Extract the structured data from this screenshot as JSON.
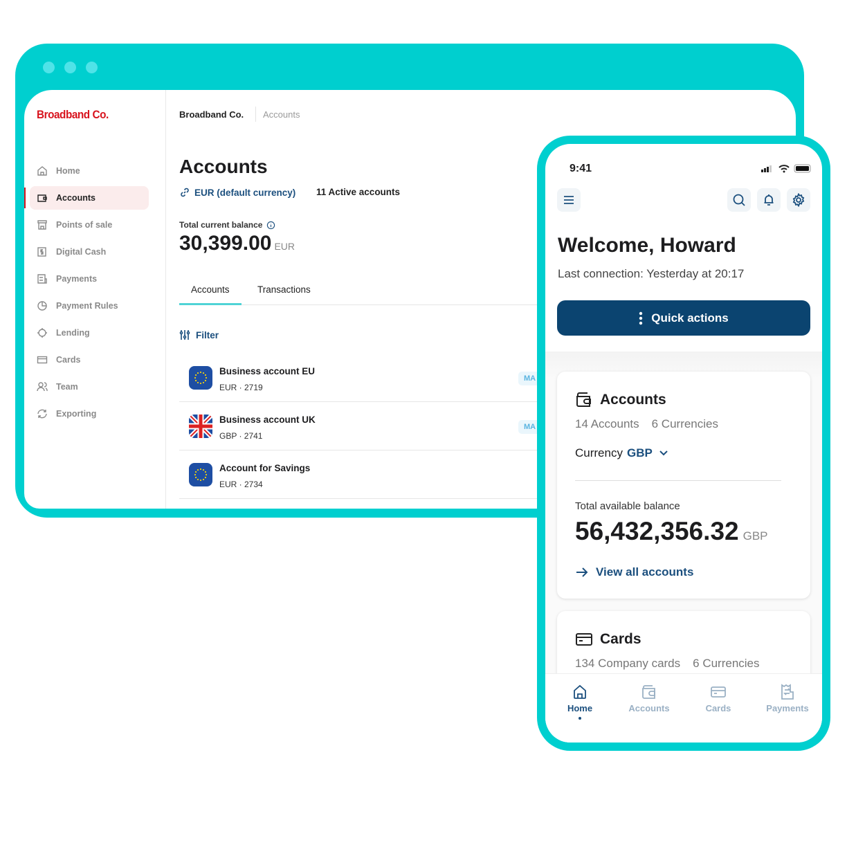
{
  "desktop": {
    "logo": "Broadband Co.",
    "sidebar": [
      {
        "label": "Home",
        "icon": "home-icon"
      },
      {
        "label": "Accounts",
        "icon": "wallet-icon",
        "active": true
      },
      {
        "label": "Points of sale",
        "icon": "store-icon"
      },
      {
        "label": "Digital Cash",
        "icon": "cash-icon"
      },
      {
        "label": "Payments",
        "icon": "payments-icon"
      },
      {
        "label": "Payment Rules",
        "icon": "pie-icon"
      },
      {
        "label": "Lending",
        "icon": "lending-icon"
      },
      {
        "label": "Cards",
        "icon": "card-icon"
      },
      {
        "label": "Team",
        "icon": "team-icon"
      },
      {
        "label": "Exporting",
        "icon": "refresh-icon"
      }
    ],
    "breadcrumb": [
      "Broadband Co.",
      "Accounts"
    ],
    "title": "Accounts",
    "currency": "EUR (default currency)",
    "active_accounts": "11 Active accounts",
    "balance_label": "Total current balance",
    "balance": "30,399.00",
    "balance_currency": "EUR",
    "tabs": [
      "Accounts",
      "Transactions"
    ],
    "filter": "Filter",
    "accounts": [
      {
        "name": "Business account EU",
        "sub": "EUR · 2719",
        "flag": "eu",
        "badge": "MA"
      },
      {
        "name": "Business account UK",
        "sub": "GBP · 2741",
        "flag": "uk",
        "badge": "MA"
      },
      {
        "name": "Account for Savings",
        "sub": "EUR · 2734",
        "flag": "eu",
        "badge": ""
      }
    ]
  },
  "mobile": {
    "time": "9:41",
    "welcome": "Welcome, Howard",
    "last_connection": "Last connection: Yesterday at 20:17",
    "quick_actions": "Quick actions",
    "accounts_card": {
      "title": "Accounts",
      "count": "14 Accounts",
      "currencies": "6 Currencies",
      "currency_label": "Currency",
      "currency_value": "GBP",
      "balance_label": "Total available balance",
      "balance": "56,432,356.32",
      "balance_currency": "GBP",
      "link": "View all accounts"
    },
    "cards_card": {
      "title": "Cards",
      "count": "134 Company cards",
      "currencies": "6 Currencies"
    },
    "bottom_nav": [
      "Home",
      "Accounts",
      "Cards",
      "Payments"
    ]
  },
  "colors": {
    "frame": "#00cfcf",
    "brand_red": "#d8141e",
    "primary": "#0b4470",
    "link": "#1b4f7e"
  }
}
